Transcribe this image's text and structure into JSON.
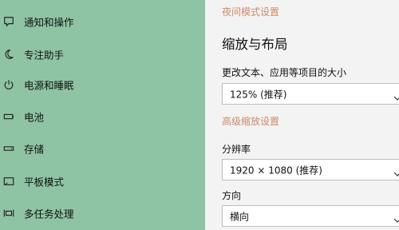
{
  "sidebar": {
    "items": [
      {
        "label": "通知和操作",
        "icon": "notification-icon"
      },
      {
        "label": "专注助手",
        "icon": "moon-icon"
      },
      {
        "label": "电源和睡眠",
        "icon": "power-icon"
      },
      {
        "label": "电池",
        "icon": "battery-icon"
      },
      {
        "label": "存储",
        "icon": "storage-icon"
      },
      {
        "label": "平板模式",
        "icon": "tablet-icon"
      },
      {
        "label": "多任务处理",
        "icon": "multitask-icon"
      }
    ]
  },
  "main": {
    "night_mode_link": "夜间模式设置",
    "section_title": "缩放与布局",
    "scale_label": "更改文本、应用等项目的大小",
    "scale_value": "125% (推荐)",
    "advanced_scale_link": "高级缩放设置",
    "resolution_label": "分辨率",
    "resolution_value": "1920 × 1080 (推荐)",
    "orientation_label": "方向",
    "orientation_value": "横向"
  },
  "colors": {
    "sidebar_bg": "#8ec4a4",
    "content_bg": "#f3f3f3",
    "link": "#c98b6b"
  }
}
